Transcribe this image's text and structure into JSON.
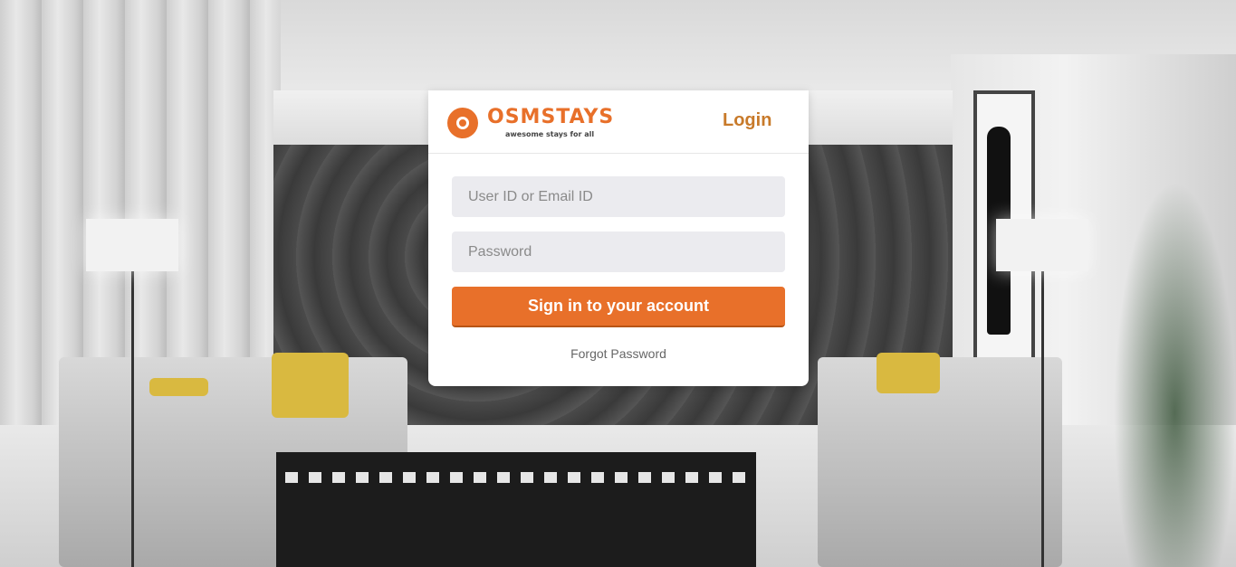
{
  "brand": {
    "name": "OSMSTAYS",
    "tagline": "awesome stays for all",
    "accent_color": "#e8702a"
  },
  "header": {
    "title": "Login"
  },
  "form": {
    "user_field": {
      "placeholder": "User ID or Email ID",
      "value": ""
    },
    "password_field": {
      "placeholder": "Password",
      "value": ""
    },
    "submit_label": "Sign in to your account",
    "forgot_label": "Forgot Password"
  },
  "background": {
    "subject": "living-room-photo"
  }
}
